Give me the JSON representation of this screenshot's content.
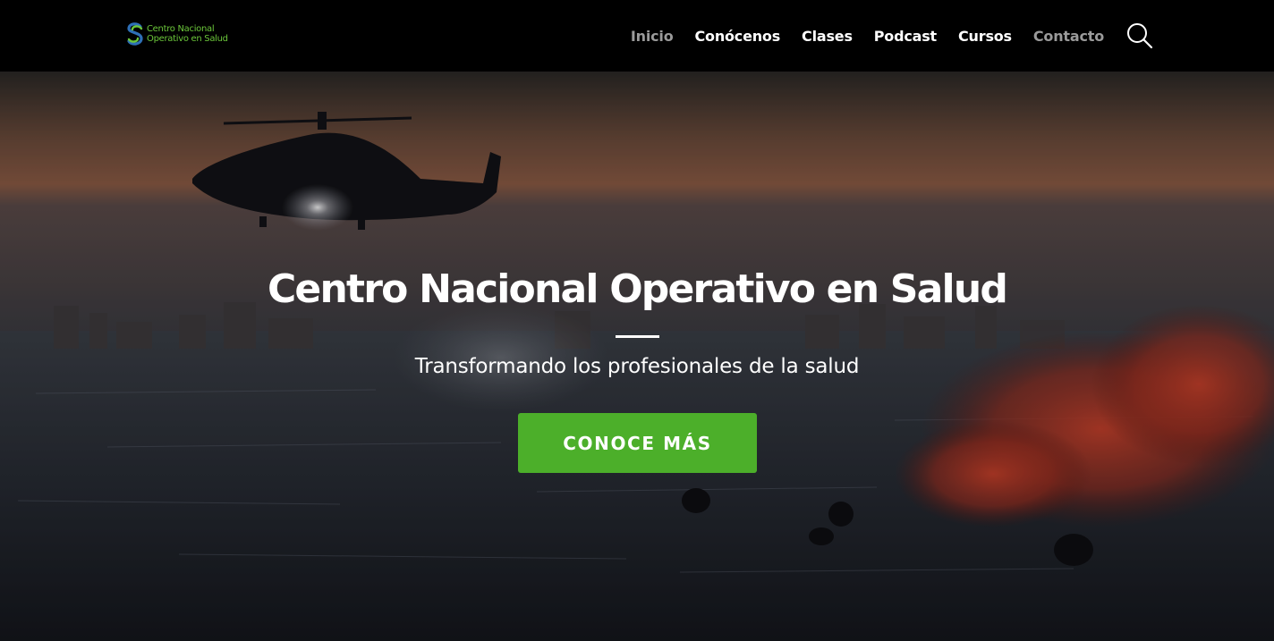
{
  "brand": {
    "name_line1": "Centro Nacional",
    "name_line2": "Operativo en Salud",
    "logo_icon": "cnos-logo-icon",
    "brand_color": "#4caf2a"
  },
  "nav": {
    "items": [
      {
        "label": "Inicio",
        "muted": true
      },
      {
        "label": "Conócenos",
        "muted": false
      },
      {
        "label": "Clases",
        "muted": false
      },
      {
        "label": "Podcast",
        "muted": false
      },
      {
        "label": "Cursos",
        "muted": false
      },
      {
        "label": "Contacto",
        "muted": true
      }
    ],
    "search_icon": "search-icon"
  },
  "hero": {
    "title": "Centro Nacional Operativo en Salud",
    "subtitle": "Transformando los profesionales de la salud",
    "cta_label": "CONOCE MÁS",
    "background": "helicopter-sea-rescue-image"
  }
}
